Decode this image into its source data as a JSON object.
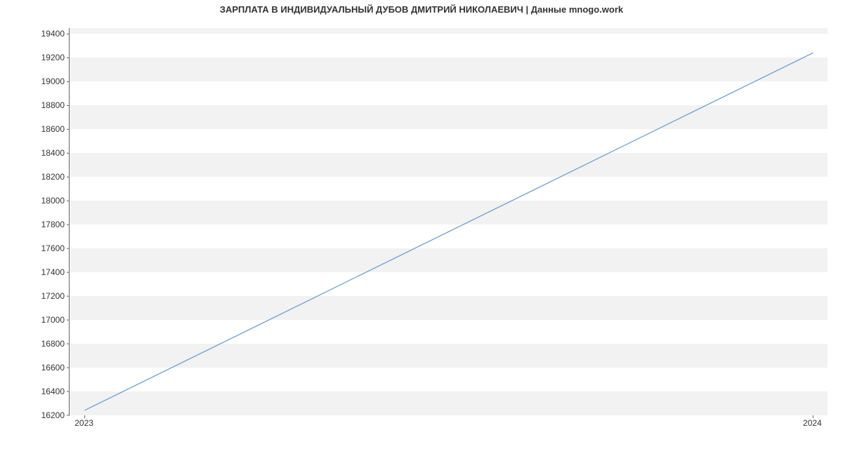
{
  "chart_data": {
    "type": "line",
    "title": "ЗАРПЛАТА В ИНДИВИДУАЛЬНЫЙ ДУБОВ ДМИТРИЙ НИКОЛАЕВИЧ | Данные mnogo.work",
    "xlabel": "",
    "ylabel": "",
    "x": [
      "2023",
      "2024"
    ],
    "values": [
      16242,
      19242
    ],
    "y_ticks": [
      16200,
      16400,
      16600,
      16800,
      17000,
      17200,
      17400,
      17600,
      17800,
      18000,
      18200,
      18400,
      18600,
      18800,
      19000,
      19200,
      19400
    ],
    "ylim": [
      16200,
      19450
    ],
    "xlim_labels": [
      "2023",
      "2024"
    ],
    "grid": true,
    "series_color": "#6699cc"
  }
}
